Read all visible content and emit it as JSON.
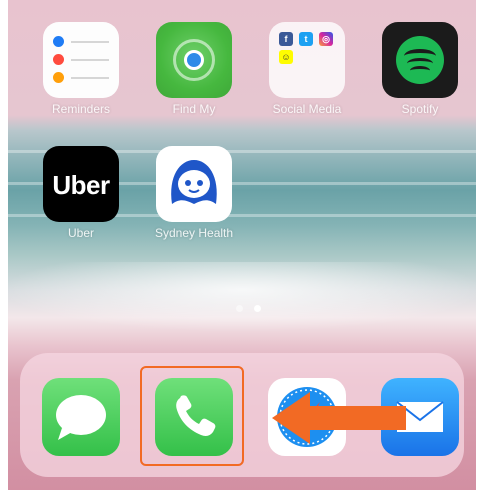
{
  "home": {
    "apps": [
      {
        "label": "Reminders",
        "icon": "reminders-icon"
      },
      {
        "label": "Find My",
        "icon": "find-my-icon"
      },
      {
        "label": "Social Media",
        "icon": "folder-icon"
      },
      {
        "label": "Spotify",
        "icon": "spotify-icon"
      },
      {
        "label": "Uber",
        "icon": "uber-icon"
      },
      {
        "label": "Sydney Health",
        "icon": "sydney-health-icon"
      }
    ],
    "uber_wordmark": "Uber",
    "page_count": 2,
    "active_page": 2
  },
  "dock": {
    "apps": [
      {
        "name": "Messages",
        "icon": "messages-icon"
      },
      {
        "name": "Phone",
        "icon": "phone-icon"
      },
      {
        "name": "Safari",
        "icon": "safari-icon"
      },
      {
        "name": "Mail",
        "icon": "mail-icon"
      }
    ]
  },
  "annotation": {
    "highlighted_app": "Phone",
    "color": "#f26a24"
  },
  "colors": {
    "reminders_blue": "#1f7cf5",
    "reminders_red": "#ff4b3e",
    "reminders_orange": "#ff9f0a",
    "spotify_green": "#1db954",
    "find_my_green": "#46b83f",
    "messages_green": "#34c049",
    "mail_blue": "#1a73e8"
  }
}
